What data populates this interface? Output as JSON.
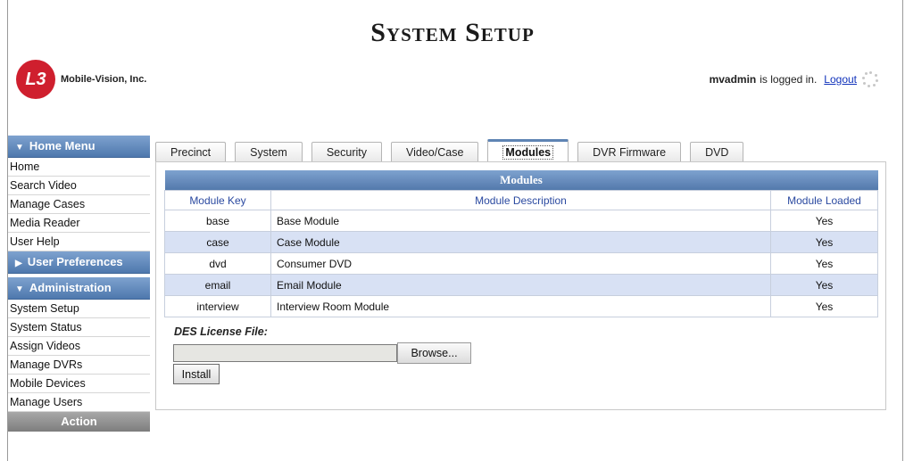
{
  "header": {
    "title": "System Setup",
    "logo_mark": "L3",
    "logo_text": "Mobile-Vision, Inc.",
    "username": "mvadmin",
    "logged_in_text": "is logged in.",
    "logout_label": "Logout"
  },
  "sidebar": {
    "home_menu": {
      "title": "Home Menu",
      "items": [
        "Home",
        "Search Video",
        "Manage Cases",
        "Media Reader",
        "User Help"
      ]
    },
    "user_preferences": {
      "title": "User Preferences"
    },
    "administration": {
      "title": "Administration",
      "items": [
        "System Setup",
        "System Status",
        "Assign Videos",
        "Manage DVRs",
        "Mobile Devices",
        "Manage Users"
      ]
    },
    "action": {
      "title": "Action"
    }
  },
  "tabs": [
    "Precinct",
    "System",
    "Security",
    "Video/Case",
    "Modules",
    "DVR Firmware",
    "DVD"
  ],
  "active_tab": "Modules",
  "modules_table": {
    "caption": "Modules",
    "columns": [
      "Module Key",
      "Module Description",
      "Module Loaded"
    ],
    "rows": [
      [
        "base",
        "Base Module",
        "Yes"
      ],
      [
        "case",
        "Case Module",
        "Yes"
      ],
      [
        "dvd",
        "Consumer DVD",
        "Yes"
      ],
      [
        "email",
        "Email Module",
        "Yes"
      ],
      [
        "interview",
        "Interview Room Module",
        "Yes"
      ]
    ]
  },
  "license": {
    "label": "DES License File:",
    "file_value": "",
    "browse_label": "Browse...",
    "install_label": "Install"
  },
  "colors": {
    "header_blue": "#5e84b4",
    "row_alt": "#d8e1f4",
    "link": "#1133bb",
    "logo_red": "#cf1f2e"
  }
}
